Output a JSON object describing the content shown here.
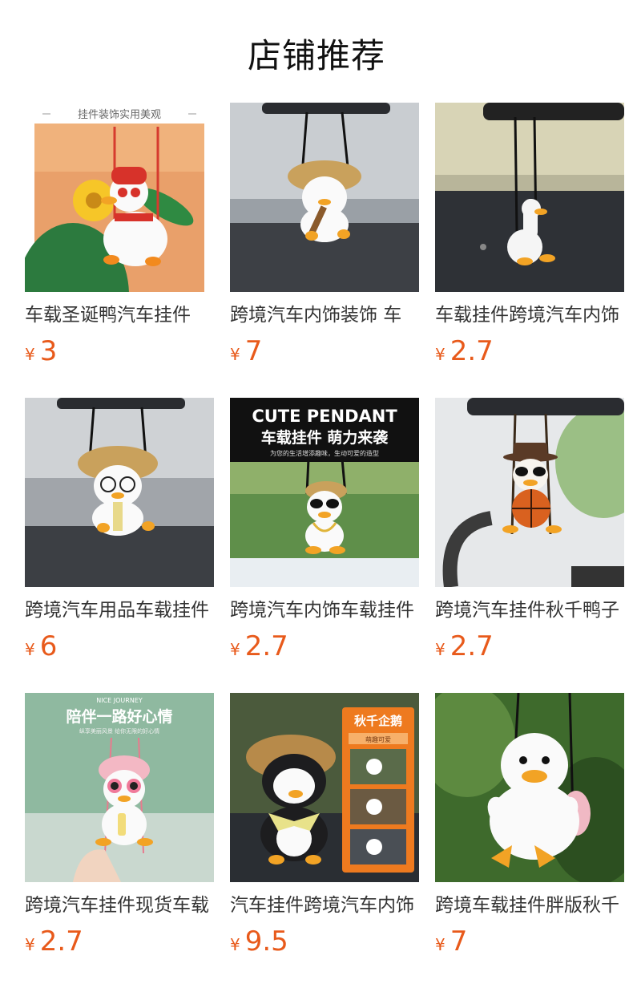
{
  "page": {
    "title": "店铺推荐"
  },
  "currency": "¥",
  "colors": {
    "price": "#e85a1b",
    "title": "#333333"
  },
  "products": [
    {
      "title": "车载圣诞鸭汽车挂件",
      "price": "3",
      "image": "red-hat-duck-swing",
      "image_caption": "挂件装饰实用美观"
    },
    {
      "title": "跨境汽车内饰装饰 车",
      "price": "7",
      "image": "penguin-straw-hat-guitar"
    },
    {
      "title": "车载挂件跨境汽车内饰",
      "price": "2.7",
      "image": "white-duck-swing"
    },
    {
      "title": "跨境汽车用品车载挂件",
      "price": "6",
      "image": "penguin-straw-hat-glasses"
    },
    {
      "title": "跨境汽车内饰车载挂件",
      "price": "2.7",
      "image": "duck-sunglasses-pendant",
      "image_banner_en": "CUTE PENDANT",
      "image_banner_cn": "车载挂件 萌力来袭",
      "image_banner_small": "为您的生活增添趣味，生动可爱的造型"
    },
    {
      "title": "跨境汽车挂件秋千鸭子",
      "price": "2.7",
      "image": "duck-basketball-cowboy-hat"
    },
    {
      "title": "跨境汽车挂件现货车载",
      "price": "2.7",
      "image": "pink-hat-penguin-hand",
      "image_banner_en": "NICE JOURNEY",
      "image_banner_cn": "陪伴一路好心情",
      "image_banner_small": "纵享美丽风景 给你无限的好心情"
    },
    {
      "title": "汽车挂件跨境汽车内饰",
      "price": "9.5",
      "image": "penguin-straw-hat-bow",
      "image_banner_cn": "秋千企鹅",
      "image_banner_small": "萌趣可爱"
    },
    {
      "title": "跨境车载挂件胖版秋千",
      "price": "7",
      "image": "chubby-duck-swing"
    }
  ]
}
